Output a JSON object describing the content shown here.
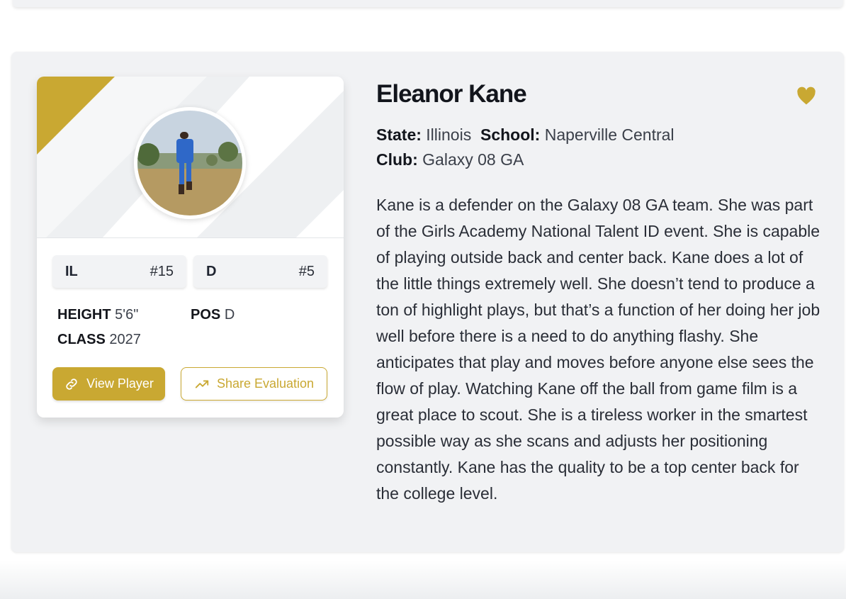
{
  "player": {
    "name": "Eleanor Kane",
    "photo_alt": "Player photo",
    "state_label": "State:",
    "state_value": "Illinois",
    "school_label": "School:",
    "school_value": "Naperville Central",
    "club_label": "Club:",
    "club_value": "Galaxy 08 GA",
    "bio": "Kane is a defender on the Galaxy 08 GA team. She was part of the Girls Academy National Talent ID event. She is capable of playing outside back and center back. Kane does a lot of the little things extremely well. She doesn’t tend to produce a ton of highlight plays, but that’s a function of her doing her job well before there is a need to do anything flashy. She anticipates that play and moves before anyone else sees the flow of play. Watching Kane off the ball from game film is a great place to scout. She is a tireless worker in the smartest possible way as she scans and adjusts her positioning constantly. Kane has the quality to be a top center back for the college level."
  },
  "chips": [
    {
      "label": "IL",
      "value": "#15"
    },
    {
      "label": "D",
      "value": "#5"
    }
  ],
  "stats": {
    "height_label": "HEIGHT",
    "height_value": "5'6\"",
    "pos_label": "POS",
    "pos_value": "D",
    "class_label": "CLASS",
    "class_value": "2027"
  },
  "buttons": {
    "view_player": "View Player",
    "share_evaluation": "Share Evaluation"
  },
  "icons": {
    "heart": "heart-icon",
    "link": "link-icon",
    "trend": "trending-up-icon"
  },
  "colors": {
    "accent_gold": "#c9a832",
    "card_bg": "#f1f2f4",
    "text_dark": "#12151c"
  }
}
